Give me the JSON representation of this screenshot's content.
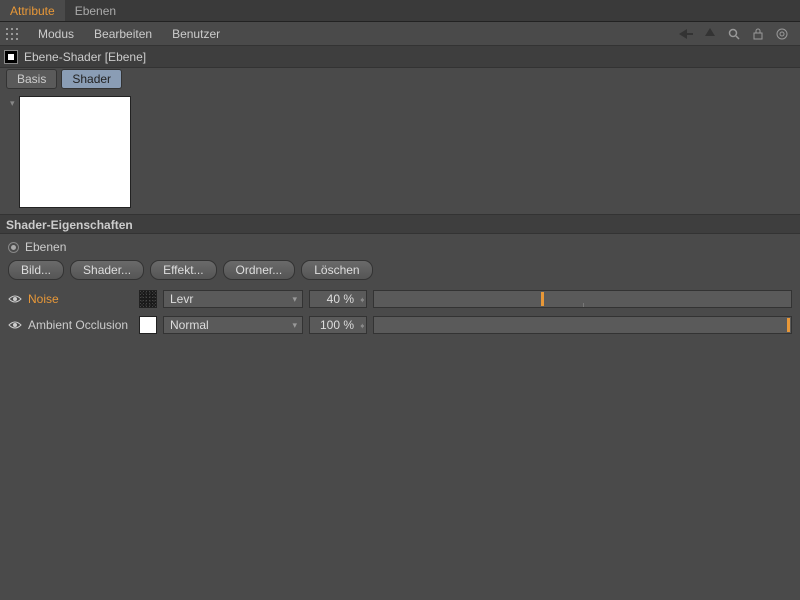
{
  "tabs": {
    "attribute": "Attribute",
    "ebenen": "Ebenen"
  },
  "menu": {
    "modus": "Modus",
    "bearbeiten": "Bearbeiten",
    "benutzer": "Benutzer"
  },
  "header": {
    "title": "Ebene-Shader [Ebene]"
  },
  "subtabs": {
    "basis": "Basis",
    "shader": "Shader"
  },
  "section": {
    "title": "Shader-Eigenschaften"
  },
  "radio": {
    "ebenen": "Ebenen"
  },
  "buttons": {
    "bild": "Bild...",
    "shader": "Shader...",
    "effekt": "Effekt...",
    "ordner": "Ordner...",
    "loeschen": "Löschen"
  },
  "layers": [
    {
      "name": "Noise",
      "highlight": true,
      "mode": "Levr",
      "percent": "40 %",
      "value": 40
    },
    {
      "name": "Ambient Occlusion",
      "highlight": false,
      "mode": "Normal",
      "percent": "100 %",
      "value": 100
    }
  ]
}
